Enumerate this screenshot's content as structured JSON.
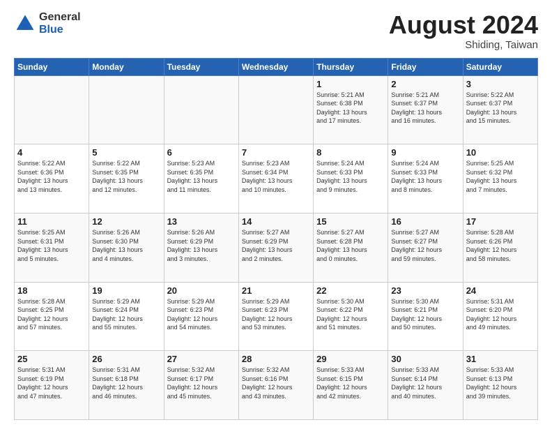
{
  "logo": {
    "line1": "General",
    "line2": "Blue"
  },
  "header": {
    "month": "August 2024",
    "location": "Shiding, Taiwan"
  },
  "weekdays": [
    "Sunday",
    "Monday",
    "Tuesday",
    "Wednesday",
    "Thursday",
    "Friday",
    "Saturday"
  ],
  "weeks": [
    [
      {
        "day": "",
        "info": ""
      },
      {
        "day": "",
        "info": ""
      },
      {
        "day": "",
        "info": ""
      },
      {
        "day": "",
        "info": ""
      },
      {
        "day": "1",
        "info": "Sunrise: 5:21 AM\nSunset: 6:38 PM\nDaylight: 13 hours\nand 17 minutes."
      },
      {
        "day": "2",
        "info": "Sunrise: 5:21 AM\nSunset: 6:37 PM\nDaylight: 13 hours\nand 16 minutes."
      },
      {
        "day": "3",
        "info": "Sunrise: 5:22 AM\nSunset: 6:37 PM\nDaylight: 13 hours\nand 15 minutes."
      }
    ],
    [
      {
        "day": "4",
        "info": "Sunrise: 5:22 AM\nSunset: 6:36 PM\nDaylight: 13 hours\nand 13 minutes."
      },
      {
        "day": "5",
        "info": "Sunrise: 5:22 AM\nSunset: 6:35 PM\nDaylight: 13 hours\nand 12 minutes."
      },
      {
        "day": "6",
        "info": "Sunrise: 5:23 AM\nSunset: 6:35 PM\nDaylight: 13 hours\nand 11 minutes."
      },
      {
        "day": "7",
        "info": "Sunrise: 5:23 AM\nSunset: 6:34 PM\nDaylight: 13 hours\nand 10 minutes."
      },
      {
        "day": "8",
        "info": "Sunrise: 5:24 AM\nSunset: 6:33 PM\nDaylight: 13 hours\nand 9 minutes."
      },
      {
        "day": "9",
        "info": "Sunrise: 5:24 AM\nSunset: 6:33 PM\nDaylight: 13 hours\nand 8 minutes."
      },
      {
        "day": "10",
        "info": "Sunrise: 5:25 AM\nSunset: 6:32 PM\nDaylight: 13 hours\nand 7 minutes."
      }
    ],
    [
      {
        "day": "11",
        "info": "Sunrise: 5:25 AM\nSunset: 6:31 PM\nDaylight: 13 hours\nand 5 minutes."
      },
      {
        "day": "12",
        "info": "Sunrise: 5:26 AM\nSunset: 6:30 PM\nDaylight: 13 hours\nand 4 minutes."
      },
      {
        "day": "13",
        "info": "Sunrise: 5:26 AM\nSunset: 6:29 PM\nDaylight: 13 hours\nand 3 minutes."
      },
      {
        "day": "14",
        "info": "Sunrise: 5:27 AM\nSunset: 6:29 PM\nDaylight: 13 hours\nand 2 minutes."
      },
      {
        "day": "15",
        "info": "Sunrise: 5:27 AM\nSunset: 6:28 PM\nDaylight: 13 hours\nand 0 minutes."
      },
      {
        "day": "16",
        "info": "Sunrise: 5:27 AM\nSunset: 6:27 PM\nDaylight: 12 hours\nand 59 minutes."
      },
      {
        "day": "17",
        "info": "Sunrise: 5:28 AM\nSunset: 6:26 PM\nDaylight: 12 hours\nand 58 minutes."
      }
    ],
    [
      {
        "day": "18",
        "info": "Sunrise: 5:28 AM\nSunset: 6:25 PM\nDaylight: 12 hours\nand 57 minutes."
      },
      {
        "day": "19",
        "info": "Sunrise: 5:29 AM\nSunset: 6:24 PM\nDaylight: 12 hours\nand 55 minutes."
      },
      {
        "day": "20",
        "info": "Sunrise: 5:29 AM\nSunset: 6:23 PM\nDaylight: 12 hours\nand 54 minutes."
      },
      {
        "day": "21",
        "info": "Sunrise: 5:29 AM\nSunset: 6:23 PM\nDaylight: 12 hours\nand 53 minutes."
      },
      {
        "day": "22",
        "info": "Sunrise: 5:30 AM\nSunset: 6:22 PM\nDaylight: 12 hours\nand 51 minutes."
      },
      {
        "day": "23",
        "info": "Sunrise: 5:30 AM\nSunset: 6:21 PM\nDaylight: 12 hours\nand 50 minutes."
      },
      {
        "day": "24",
        "info": "Sunrise: 5:31 AM\nSunset: 6:20 PM\nDaylight: 12 hours\nand 49 minutes."
      }
    ],
    [
      {
        "day": "25",
        "info": "Sunrise: 5:31 AM\nSunset: 6:19 PM\nDaylight: 12 hours\nand 47 minutes."
      },
      {
        "day": "26",
        "info": "Sunrise: 5:31 AM\nSunset: 6:18 PM\nDaylight: 12 hours\nand 46 minutes."
      },
      {
        "day": "27",
        "info": "Sunrise: 5:32 AM\nSunset: 6:17 PM\nDaylight: 12 hours\nand 45 minutes."
      },
      {
        "day": "28",
        "info": "Sunrise: 5:32 AM\nSunset: 6:16 PM\nDaylight: 12 hours\nand 43 minutes."
      },
      {
        "day": "29",
        "info": "Sunrise: 5:33 AM\nSunset: 6:15 PM\nDaylight: 12 hours\nand 42 minutes."
      },
      {
        "day": "30",
        "info": "Sunrise: 5:33 AM\nSunset: 6:14 PM\nDaylight: 12 hours\nand 40 minutes."
      },
      {
        "day": "31",
        "info": "Sunrise: 5:33 AM\nSunset: 6:13 PM\nDaylight: 12 hours\nand 39 minutes."
      }
    ]
  ]
}
